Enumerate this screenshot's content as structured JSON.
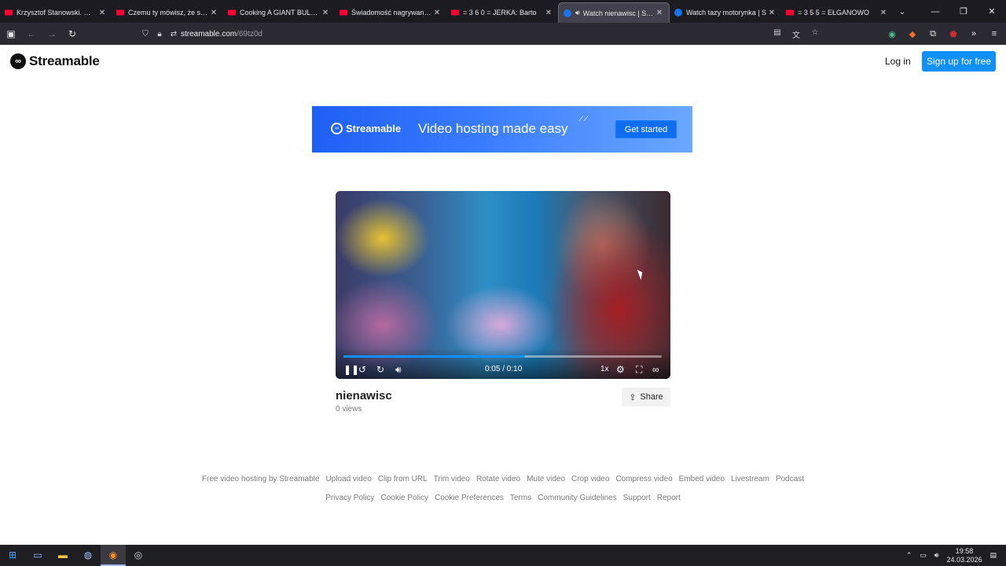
{
  "browser": {
    "tabs": [
      {
        "title": "Krzysztof Stanowski. W jakiej",
        "favicon": "youtube-icon",
        "active": false
      },
      {
        "title": "Czemu ty mówisz, że się na c",
        "favicon": "youtube-icon",
        "active": false
      },
      {
        "title": "Cooking A GIANT BULL For A",
        "favicon": "youtube-icon",
        "active": false
      },
      {
        "title": "Świadomość nagrywania (Gir",
        "favicon": "youtube-icon",
        "active": false
      },
      {
        "title": "= 3 6 0 = JERKA: Barto",
        "favicon": "youtube-icon",
        "active": false
      },
      {
        "title": "Watch nienawisc | Stream",
        "favicon": "streamable-icon",
        "active": true
      },
      {
        "title": "Watch tazy motorynka | S",
        "favicon": "streamable-icon",
        "active": false
      },
      {
        "title": "= 3 5 5 = EŁGANOWO",
        "favicon": "youtube-icon",
        "active": false
      }
    ],
    "url_host": "streamable.com",
    "url_path": "/69tz0d"
  },
  "header": {
    "logo_text": "Streamable",
    "login_label": "Log in",
    "signup_label": "Sign up for free"
  },
  "banner": {
    "logo_text": "Streamable",
    "tagline": "Video hosting made easy",
    "cta_label": "Get started"
  },
  "video": {
    "current_time": "0:05",
    "duration": "0:10",
    "time_display": "0:05 / 0:10",
    "progress_fraction": 0.57,
    "speed_label": "1x",
    "title": "nienawisc",
    "views": "0 views",
    "share_label": "Share"
  },
  "footer": {
    "row1": [
      "Free video hosting by Streamable",
      "Upload video",
      "Clip from URL",
      "Trim video",
      "Rotate video",
      "Mute video",
      "Crop video",
      "Compress video",
      "Embed video",
      "Livestream",
      "Podcast"
    ],
    "row2": [
      "Privacy Policy",
      "Cookie Policy",
      "Cookie Preferences",
      "Terms",
      "Community Guidelines",
      "Support",
      "Report"
    ]
  },
  "taskbar": {
    "time": "19:58",
    "date": "24.03.2026"
  },
  "colors": {
    "accent": "#0f90fa",
    "banner_start": "#1f5ff5"
  }
}
